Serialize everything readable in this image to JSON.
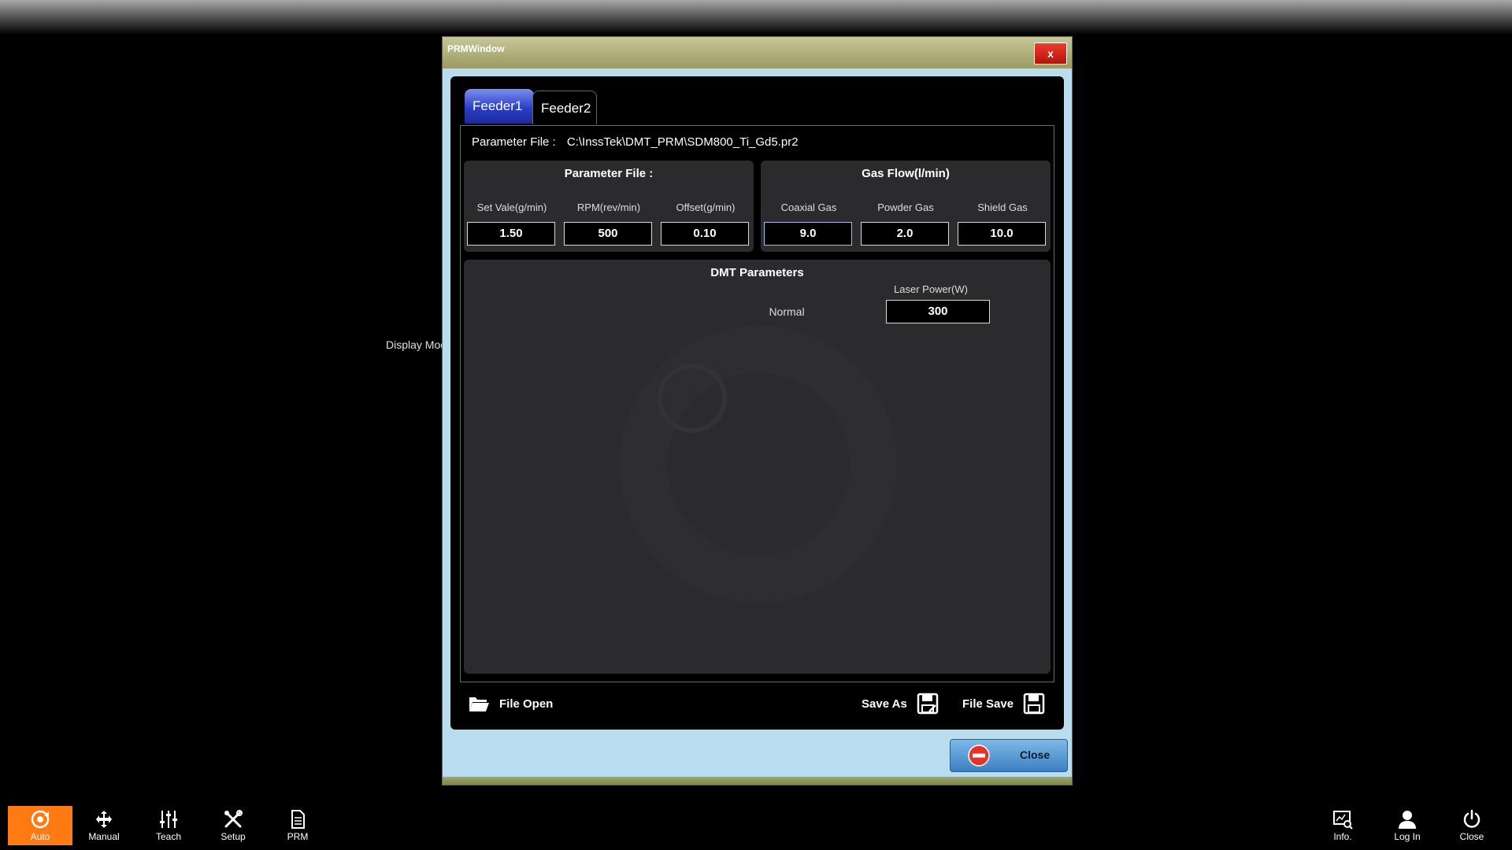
{
  "window": {
    "title": "PRMWindow",
    "close_x": "x"
  },
  "background": {
    "display_mode_label": "Display Mod"
  },
  "tabs": [
    {
      "label": "Feeder1",
      "active": true
    },
    {
      "label": "Feeder2",
      "active": false
    }
  ],
  "parameter_file": {
    "label": "Parameter File :",
    "path": "C:\\InssTek\\DMT_PRM\\SDM800_Ti_Gd5.pr2"
  },
  "feeder_group": {
    "title": "Parameter File :",
    "fields": [
      {
        "label": "Set Vale(g/min)",
        "value": "1.50"
      },
      {
        "label": "RPM(rev/min)",
        "value": "500"
      },
      {
        "label": "Offset(g/min)",
        "value": "0.10"
      }
    ]
  },
  "gas_group": {
    "title": "Gas Flow(l/min)",
    "fields": [
      {
        "label": "Coaxial Gas",
        "value": "9.0"
      },
      {
        "label": "Powder Gas",
        "value": "2.0"
      },
      {
        "label": "Shield Gas",
        "value": "10.0"
      }
    ]
  },
  "dmt_group": {
    "title": "DMT Parameters",
    "column_label": "Laser Power(W)",
    "row_label": "Normal",
    "value": "300"
  },
  "actions": {
    "file_open": "File Open",
    "save_as": "Save As",
    "file_save": "File Save",
    "close": "Close"
  },
  "taskbar": {
    "left": [
      {
        "label": "Auto",
        "icon": "auto-icon",
        "active": true
      },
      {
        "label": "Manual",
        "icon": "move-arrows-icon"
      },
      {
        "label": "Teach",
        "icon": "sliders-icon"
      },
      {
        "label": "Setup",
        "icon": "tools-icon"
      },
      {
        "label": "PRM",
        "icon": "document-icon"
      }
    ],
    "right": [
      {
        "label": "Info.",
        "icon": "info-chart-icon"
      },
      {
        "label": "Log In",
        "icon": "user-icon"
      },
      {
        "label": "Close",
        "icon": "power-icon"
      }
    ]
  },
  "colors": {
    "accent_tab": "#2b3fc6",
    "taskbar_active": "#ff7a12",
    "window_bg": "#b9ddee",
    "group_bg": "#2b2b2d"
  }
}
